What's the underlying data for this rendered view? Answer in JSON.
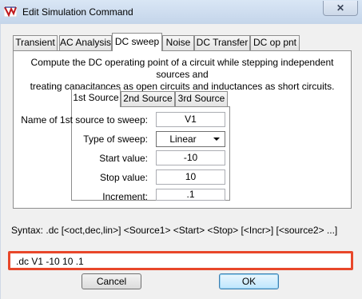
{
  "window": {
    "title": "Edit Simulation Command",
    "close_label": "✕"
  },
  "tabs": [
    {
      "label": "Transient",
      "active": false
    },
    {
      "label": "AC Analysis",
      "active": false
    },
    {
      "label": "DC sweep",
      "active": true
    },
    {
      "label": "Noise",
      "active": false
    },
    {
      "label": "DC Transfer",
      "active": false
    },
    {
      "label": "DC op pnt",
      "active": false
    }
  ],
  "dc_sweep": {
    "description_line1": "Compute the DC operating point of a circuit while stepping independent sources and",
    "description_line2": "treating capacitances as open circuits and inductances as short circuits.",
    "source_tabs": [
      {
        "label": "1st Source",
        "active": true
      },
      {
        "label": "2nd Source",
        "active": false
      },
      {
        "label": "3rd Source",
        "active": false
      }
    ],
    "fields": {
      "source_name_label": "Name of 1st source to sweep:",
      "source_name_value": "V1",
      "sweep_type_label": "Type of sweep:",
      "sweep_type_value": "Linear",
      "start_label": "Start value:",
      "start_value": "-10",
      "stop_label": "Stop value:",
      "stop_value": "10",
      "increment_label": "Increment:",
      "increment_value": ".1"
    }
  },
  "syntax_text": "Syntax:  .dc [<oct,dec,lin>] <Source1> <Start> <Stop> [<Incr>] [<source2> ...]",
  "command_text": ".dc V1 -10 10 .1",
  "buttons": {
    "cancel": "Cancel",
    "ok": "OK"
  },
  "colors": {
    "highlight_border": "#e8472a",
    "ok_button": "#bee6fd"
  }
}
